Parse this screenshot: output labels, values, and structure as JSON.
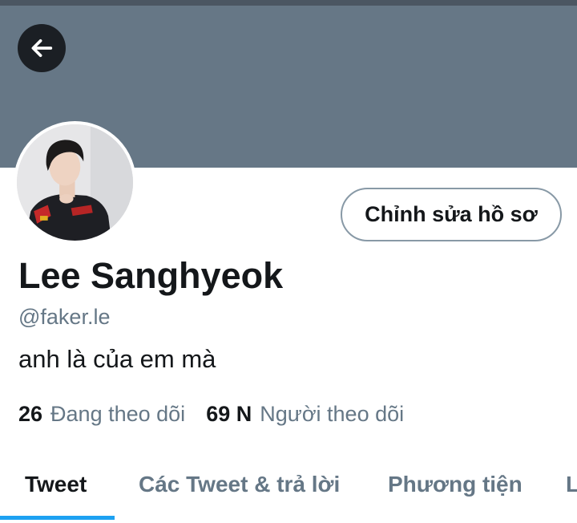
{
  "header": {
    "back_icon": "arrow-left-icon",
    "banner_color": "#667786"
  },
  "profile": {
    "edit_button_label": "Chỉnh sửa hồ sơ",
    "display_name": "Lee Sanghyeok",
    "handle": "@faker.le",
    "bio": "anh là của em mà",
    "following_count": "26",
    "following_label": "Đang theo dõi",
    "followers_count": "69 N",
    "followers_label": "Người theo dõi"
  },
  "tabs": [
    {
      "label": "Tweet",
      "active": true
    },
    {
      "label": "Các Tweet & trả lời",
      "active": false
    },
    {
      "label": "Phương tiện",
      "active": false
    },
    {
      "label": "L",
      "active": false
    }
  ],
  "colors": {
    "accent": "#1da1f2",
    "secondary_text": "#657786",
    "primary_text": "#14171a"
  }
}
